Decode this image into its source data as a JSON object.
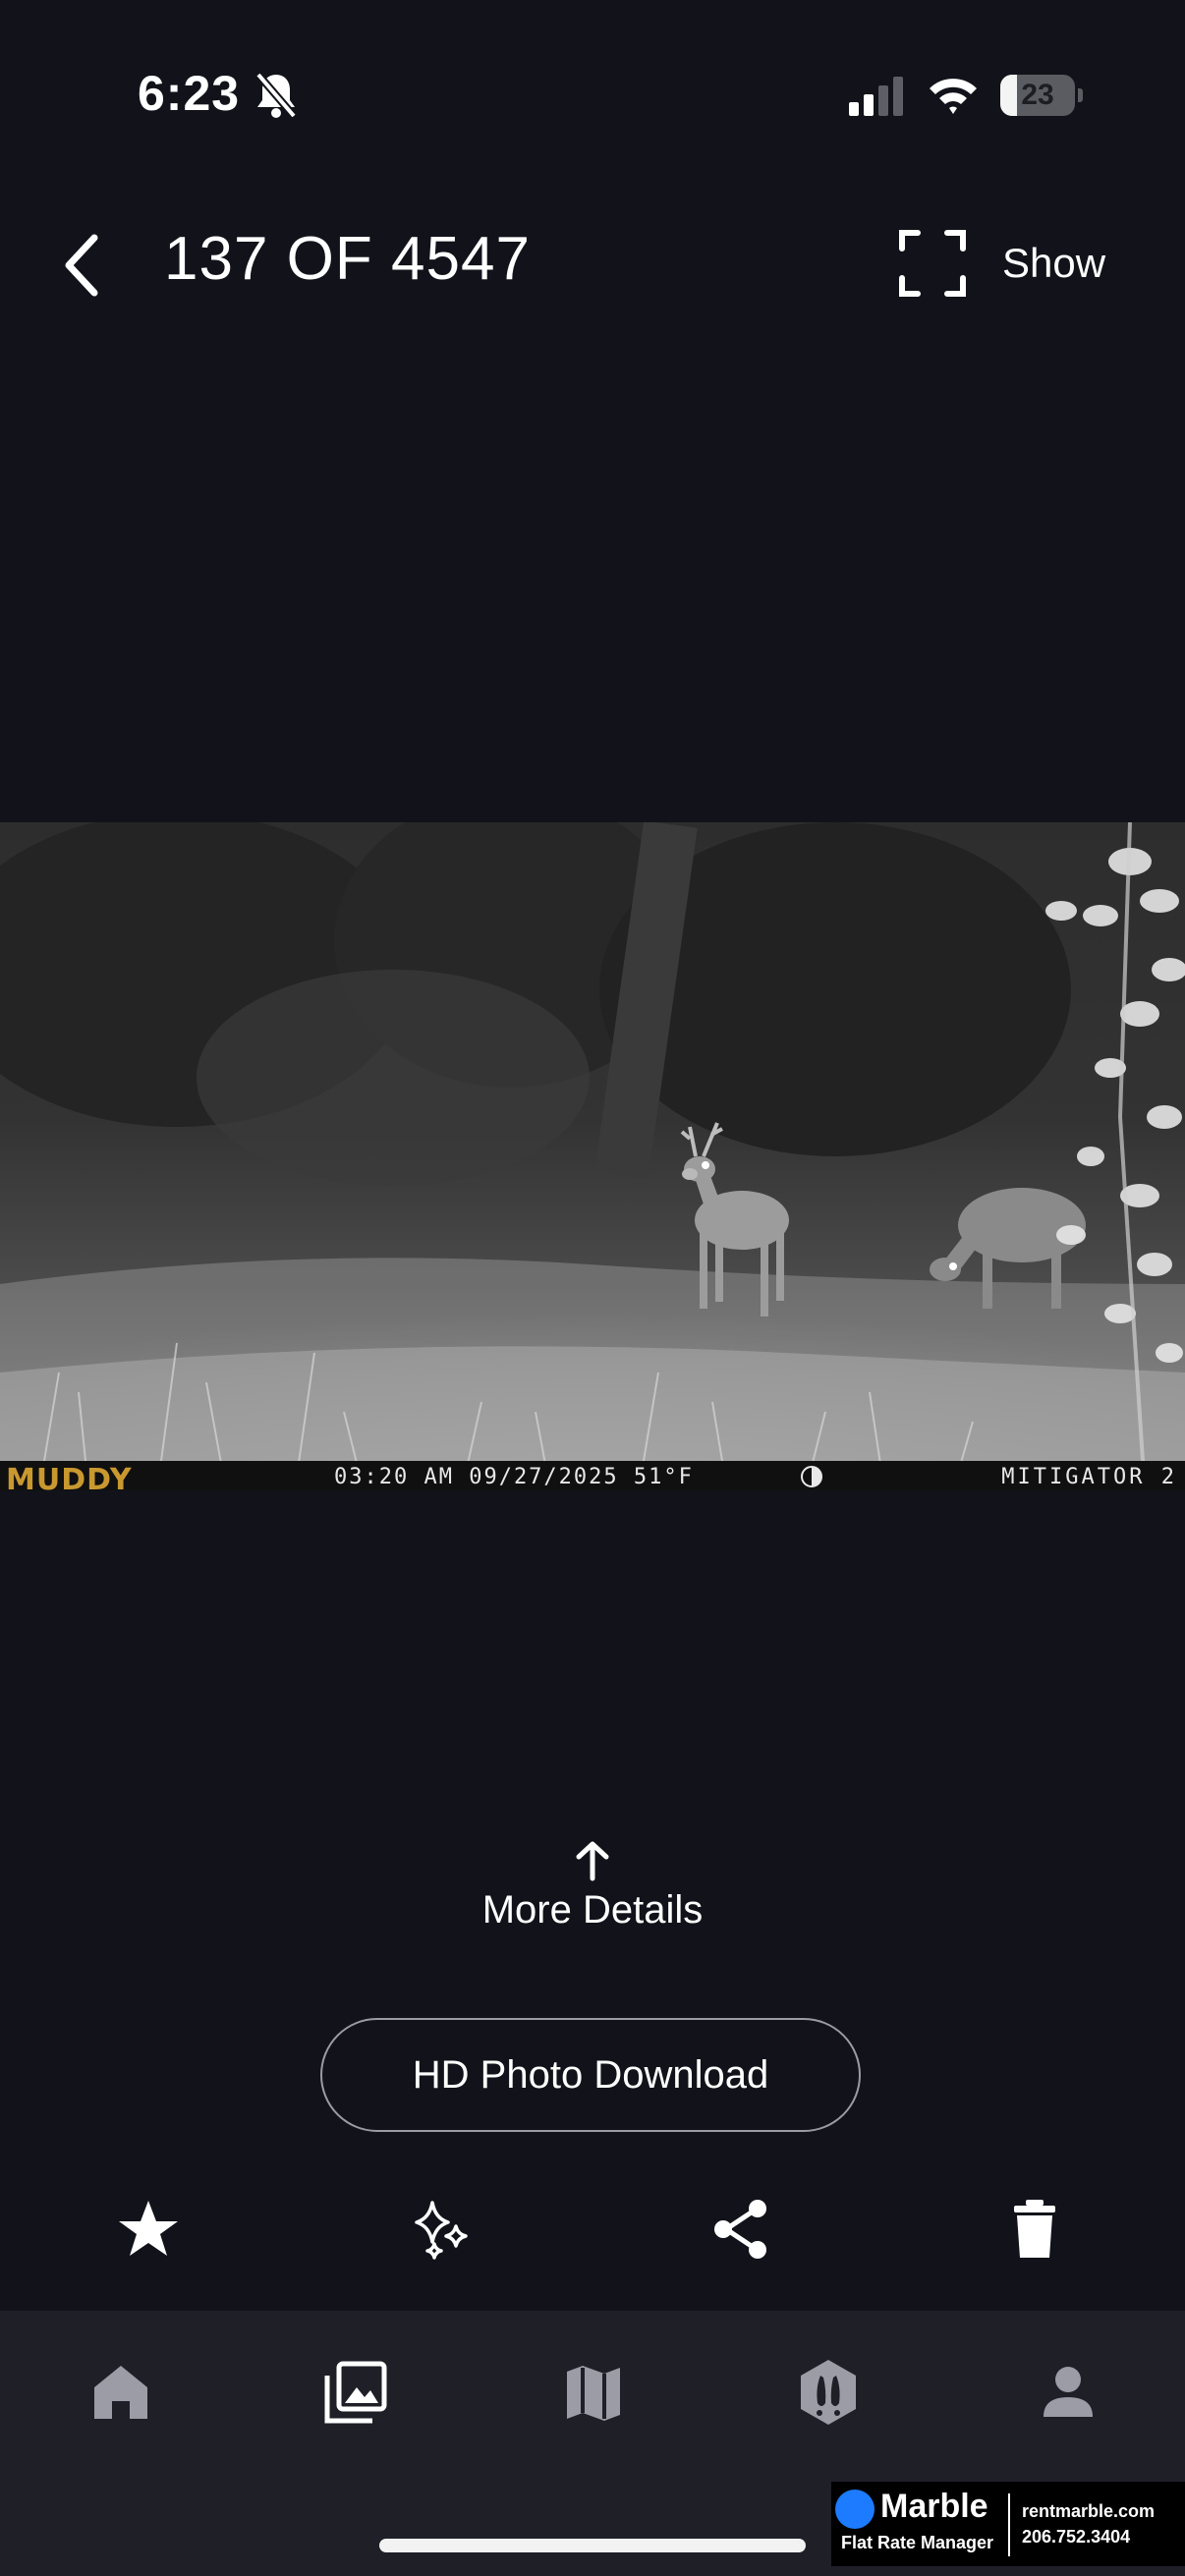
{
  "status_bar": {
    "time": "6:23",
    "battery_level": "23",
    "battery_fraction": 0.23,
    "icons": [
      "bell-slash-icon",
      "cellular-signal-icon",
      "wifi-icon",
      "battery-icon"
    ]
  },
  "header": {
    "counter": "137 OF 4547",
    "show_label": "Show",
    "icons": [
      "chevron-left-icon",
      "fullscreen-icon"
    ]
  },
  "photo": {
    "brand": "MUDDY",
    "stamp": "03:20 AM 09/27/2025 51°F",
    "camera_name": "MITIGATOR 2"
  },
  "details": {
    "more_details_label": "More Details",
    "hd_download_label": "HD Photo Download"
  },
  "actions": [
    {
      "name": "favorite",
      "icon": "star-icon"
    },
    {
      "name": "enhance",
      "icon": "sparkles-icon"
    },
    {
      "name": "share",
      "icon": "share-icon"
    },
    {
      "name": "delete",
      "icon": "trash-icon"
    }
  ],
  "tab_bar": [
    {
      "name": "home",
      "icon": "home-icon",
      "active": false
    },
    {
      "name": "gallery",
      "icon": "gallery-icon",
      "active": true
    },
    {
      "name": "map",
      "icon": "map-icon",
      "active": false
    },
    {
      "name": "tracks",
      "icon": "hoof-print-icon",
      "active": false
    },
    {
      "name": "profile",
      "icon": "person-icon",
      "active": false
    }
  ],
  "ad": {
    "name": "Marble",
    "tagline": "Flat Rate Manager",
    "url": "rentmarble.com",
    "phone": "206.752.3404"
  },
  "colors": {
    "background": "#12131a",
    "tab_bar": "#1e1f27",
    "inactive_icon": "#9b9ca6",
    "active_icon": "#ffffff",
    "brand_gold": "#c9982f",
    "marble_blue": "#1c7bff"
  }
}
